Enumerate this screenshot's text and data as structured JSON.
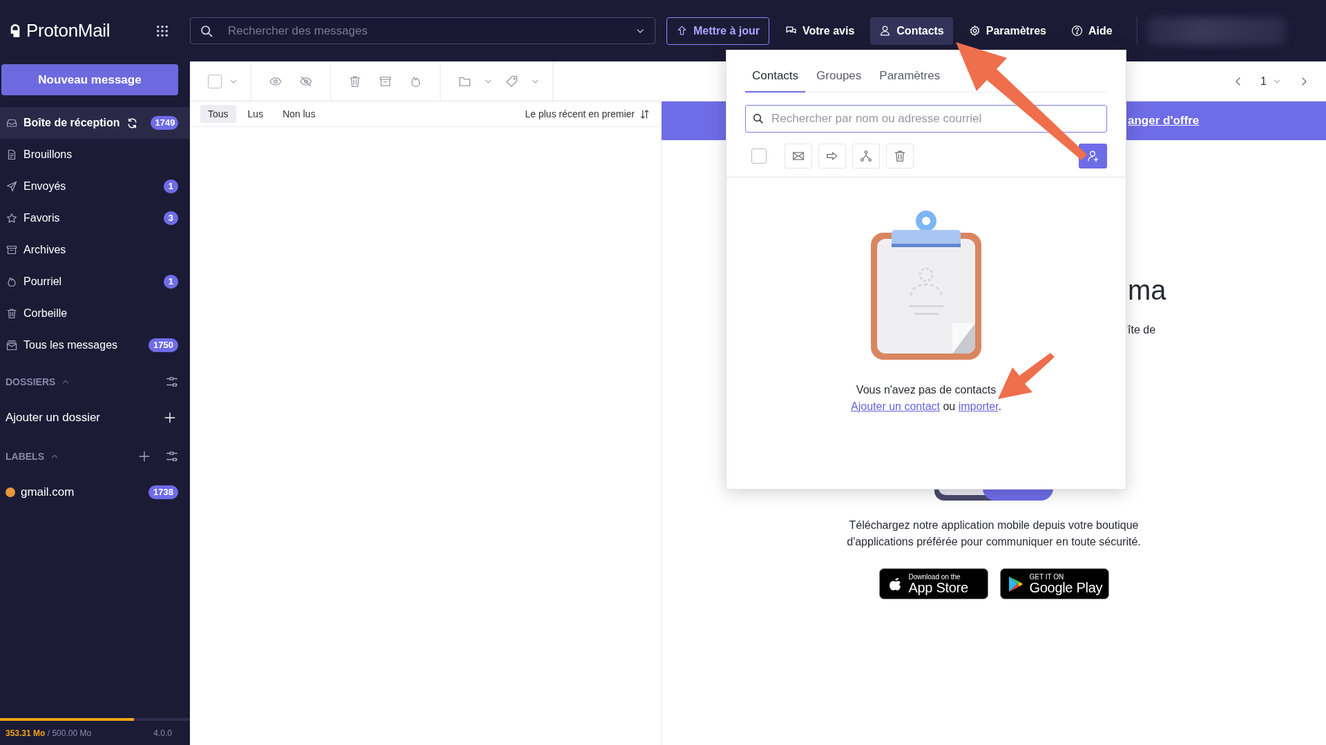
{
  "app": {
    "logo": "ProtonMail"
  },
  "topbar": {
    "search": {
      "placeholder": "Rechercher des messages"
    },
    "buttons": [
      {
        "label": "Mettre à jour",
        "kind": "upgrade",
        "selected": false
      },
      {
        "label": "Votre avis",
        "kind": "feedback",
        "selected": false
      },
      {
        "label": "Contacts",
        "kind": "contacts",
        "selected": true
      },
      {
        "label": "Paramètres",
        "kind": "settings",
        "selected": false
      },
      {
        "label": "Aide",
        "kind": "help",
        "selected": false
      }
    ]
  },
  "sidebar": {
    "compose": "Nouveau message",
    "folders": [
      {
        "label": "Boîte de réception",
        "kind": "inbox",
        "selected": true,
        "count": "1749",
        "refresh": true
      },
      {
        "label": "Brouillons",
        "kind": "drafts",
        "selected": false
      },
      {
        "label": "Envoyés",
        "kind": "sent",
        "selected": false,
        "count": "1"
      },
      {
        "label": "Favoris",
        "kind": "starred",
        "selected": false,
        "count": "3"
      },
      {
        "label": "Archives",
        "kind": "archive",
        "selected": false
      },
      {
        "label": "Pourriel",
        "kind": "spam",
        "selected": false,
        "count": "1"
      },
      {
        "label": "Corbeille",
        "kind": "trash",
        "selected": false
      },
      {
        "label": "Tous les messages",
        "kind": "all",
        "selected": false,
        "count": "1750"
      }
    ],
    "dossiers": {
      "title": "DOSSIERS",
      "expanded": true,
      "add": "Ajouter un dossier"
    },
    "labels": {
      "title": "LABELS",
      "expanded": true,
      "items": [
        {
          "label": "gmail.com",
          "color": "#e8973e",
          "count": "1738",
          "selected": false
        }
      ]
    },
    "storage": {
      "usage": "**353.31 Mo** / 500.00 Mo",
      "level": 0.7066,
      "version": "4.0.0"
    }
  },
  "toolbar": {
    "select_all": {
      "checked": false
    },
    "page": "1"
  },
  "filters": [
    {
      "label": "Tous",
      "selected": true
    },
    {
      "label": "Lus",
      "selected": false
    },
    {
      "label": "Non lus",
      "selected": false
    }
  ],
  "sort": "Le plus récent en premier",
  "banner": {
    "link": "anger d'offre"
  },
  "welcome": {
    "heading": "ma",
    "text": "îte de",
    "download": "Téléchargez notre application mobile depuis votre boutique d'applications préférée pour communiquer en toute sécurité.",
    "stores": [
      {
        "kind": "apple",
        "small": "Download on the",
        "large": "App Store"
      },
      {
        "kind": "google",
        "small": "GET IT ON",
        "large": "Google Play"
      }
    ]
  },
  "contacts_popup": {
    "tabs": [
      {
        "label": "Contacts",
        "selected": true
      },
      {
        "label": "Groupes",
        "selected": false
      },
      {
        "label": "Paramètres",
        "selected": false
      }
    ],
    "search": {
      "placeholder": "Rechercher par nom ou adresse courriel"
    },
    "select_all": {
      "checked": false
    },
    "empty": {
      "message": "Vous n'avez pas de contacts",
      "add_link": "Ajouter un contact",
      "separator": "ou",
      "import_link": "importer",
      "end": "."
    }
  }
}
